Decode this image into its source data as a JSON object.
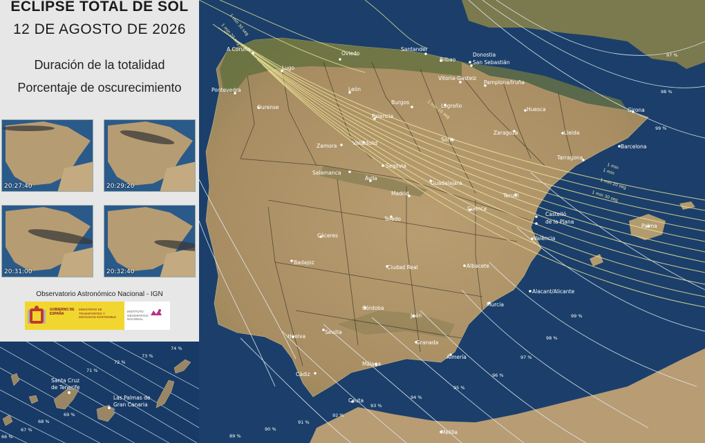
{
  "panel": {
    "title": "ECLIPSE TOTAL DE SOL",
    "date": "12 DE AGOSTO DE 2026",
    "subtitle1": "Duración de la totalidad",
    "subtitle2": "Porcentaje de oscurecimiento",
    "thumbnails": [
      {
        "time": "20:27:40"
      },
      {
        "time": "20:29:20"
      },
      {
        "time": "20:31:00"
      },
      {
        "time": "20:32:40"
      }
    ],
    "observatory": "Observatorio Astronómico Nacional - IGN",
    "logo_gobierno": "GOBIERNO DE ESPAÑA",
    "logo_ministerio": "MINISTERIO DE TRANSPORTES Y MOVILIDAD SOSTENIBLE",
    "logo_ign": "INSTITUTO GEOGRÁFICO NACIONAL"
  },
  "canarias": {
    "cities": [
      "Santa Cruz de Tenerife",
      "Las Palmas de Gran Canaria"
    ],
    "city_lines": [
      [
        "Santa Cruz",
        "de Tenerife"
      ],
      [
        "Las Palmas de",
        "Gran Canaria"
      ]
    ],
    "percent_labels": [
      "74 %",
      "73 %",
      "72 %",
      "71 %",
      "70 %",
      "69 %",
      "68 %",
      "67 %",
      "66 %"
    ]
  },
  "map": {
    "cities": [
      "A Coruña",
      "Lugo",
      "Oviedo",
      "Santander",
      "Bilbao",
      "Donostia",
      "San Sebastián",
      "Pontevedra",
      "Ourense",
      "León",
      "Burgos",
      "Vitoria-Gasteiz",
      "Pamplona/Iruña",
      "Logroño",
      "Palencia",
      "Huesca",
      "Girona",
      "Zamora",
      "Valladolid",
      "Soria",
      "Zaragoza",
      "Lleida",
      "Barcelona",
      "Salamanca",
      "Segovia",
      "Tarragona",
      "Ávila",
      "Guadalajara",
      "Madrid",
      "Teruel",
      "Cuenca",
      "Castelló",
      "de la Plana",
      "Palma",
      "Toledo",
      "Cáceres",
      "València",
      "Badajoz",
      "Ciudad Real",
      "Albacete",
      "Alacant/Alicante",
      "Murcia",
      "Córdoba",
      "Jaén",
      "Huelva",
      "Sevilla",
      "Granada",
      "Almería",
      "Cádiz",
      "Málaga",
      "Ceuta",
      "Melilla"
    ],
    "duration_labels": [
      "1 min 30 seg",
      "1 min 20 seg",
      "1 min 10 seg",
      "1 min",
      "1 min 20 seg",
      "1 min 30 seg",
      "1 min"
    ],
    "percent_labels": [
      "97 %",
      "98 %",
      "99 %",
      "99 %",
      "98 %",
      "97 %",
      "96 %",
      "95 %",
      "94 %",
      "93 %",
      "92 %",
      "91 %",
      "90 %",
      "89 %"
    ]
  },
  "colors": {
    "sea": "#1b3f6a",
    "land": "#b89a6e",
    "totality_lines": "#f0e89a",
    "percent_lines": "#e6eef5",
    "panel_bg": "#e6e7e6"
  }
}
